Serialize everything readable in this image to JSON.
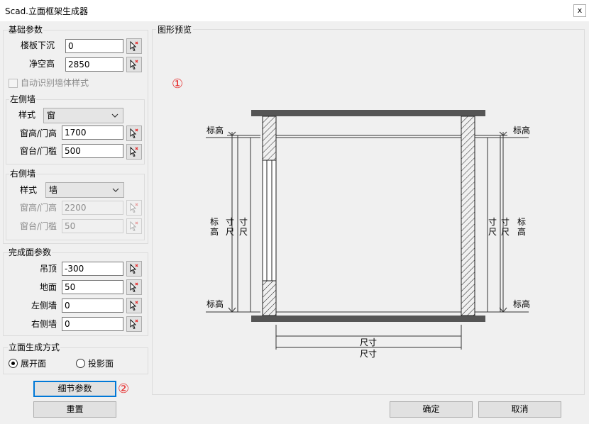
{
  "window": {
    "title": "Scad.立面框架生成器",
    "close_glyph": "x"
  },
  "basic": {
    "title": "基础参数",
    "floor_drop_label": "楼板下沉",
    "floor_drop_value": "0",
    "clear_height_label": "净空高",
    "clear_height_value": "2850",
    "auto_detect_label": "自动识别墙体样式"
  },
  "left_wall": {
    "title": "左侧墙",
    "style_label": "样式",
    "style_value": "窗",
    "height_label": "窗高/门高",
    "height_value": "1700",
    "sill_label": "窗台/门槛",
    "sill_value": "500"
  },
  "right_wall": {
    "title": "右侧墙",
    "style_label": "样式",
    "style_value": "墙",
    "height_label": "窗高/门高",
    "height_value": "2200",
    "sill_label": "窗台/门槛",
    "sill_value": "50"
  },
  "finish": {
    "title": "完成面参数",
    "ceiling_label": "吊顶",
    "ceiling_value": "-300",
    "floor_label": "地面",
    "floor_value": "50",
    "left_label": "左侧墙",
    "left_value": "0",
    "right_label": "右侧墙",
    "right_value": "0"
  },
  "mode": {
    "title": "立面生成方式",
    "option1": "展开面",
    "option2": "投影面",
    "selected": "展开面"
  },
  "buttons": {
    "detail": "细节参数",
    "reset": "重置",
    "ok": "确定",
    "cancel": "取消"
  },
  "preview": {
    "title": "图形预览",
    "marker1": "①",
    "marker2": "②",
    "elev": "标高",
    "elev_v": "标\n高",
    "dim": "尺寸",
    "dim_v": "尺\n寸",
    "cun_chi_v": "寸\n尺"
  },
  "colors": {
    "accent_red": "#e62b2b",
    "focus_blue": "#0078d7",
    "slab": "#555555"
  }
}
